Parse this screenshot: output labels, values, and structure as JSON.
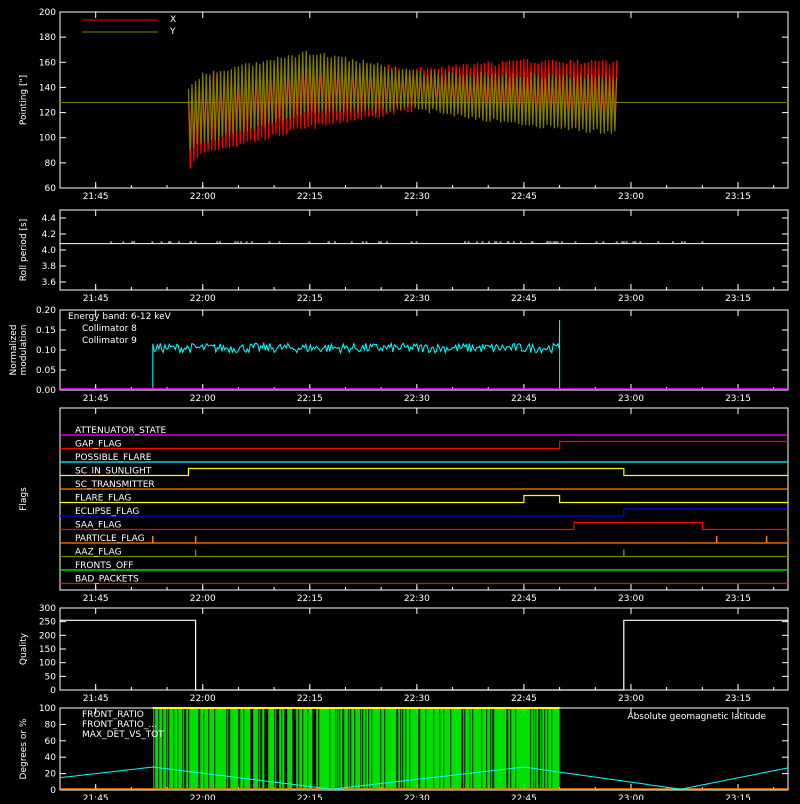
{
  "time_axis": {
    "start": "21:40",
    "end": "23:22",
    "tick_labels": [
      "21:45",
      "22:00",
      "22:15",
      "22:30",
      "22:45",
      "23:00",
      "23:15"
    ]
  },
  "chart_data": [
    {
      "type": "line",
      "name": "pointing",
      "ylabel": "Pointing [\"]",
      "ylim": [
        60,
        200
      ],
      "yticks": [
        "60",
        "80",
        "100",
        "120",
        "140",
        "160",
        "180",
        "200"
      ],
      "legend_placement": "top-left",
      "series": [
        {
          "name": "X",
          "color": "#ff0000",
          "envelope": {
            "time": [
              "21:58",
              "22:00",
              "22:15",
              "22:30",
              "22:45",
              "22:58"
            ],
            "upper": [
              132,
              148,
              162,
              154,
              161,
              160
            ],
            "lower": [
              75,
              88,
              108,
              123,
              114,
              107
            ]
          }
        },
        {
          "name": "Y",
          "color": "#808000",
          "envelope": {
            "time": [
              "21:58",
              "22:00",
              "22:15",
              "22:30",
              "22:45",
              "22:58"
            ],
            "upper": [
              140,
              150,
              168,
              152,
              150,
              148
            ],
            "lower": [
              90,
              96,
              120,
              123,
              110,
              104
            ]
          }
        }
      ],
      "reference_line": {
        "value": 128,
        "color": "#808000"
      }
    },
    {
      "type": "line",
      "name": "roll-period",
      "ylabel": "Roll period [s]",
      "ylim": [
        3.5,
        4.5
      ],
      "yticks": [
        "3.6",
        "3.8",
        "4.0",
        "4.2",
        "4.4"
      ],
      "series": [
        {
          "name": "",
          "color": "#ffffff",
          "value": 4.08
        }
      ]
    },
    {
      "type": "line",
      "name": "modulation",
      "ylabel": "Normalized modulation",
      "ylim": [
        0.0,
        0.2
      ],
      "yticks": [
        "0.00",
        "0.05",
        "0.10",
        "0.15",
        "0.20"
      ],
      "annotation": "Energy band: 6-12 keV",
      "legend_placement": "top-left",
      "series": [
        {
          "name": "Collimator 8",
          "color": "#00ffff",
          "time_range": [
            "21:53",
            "22:50"
          ],
          "mean": 0.105,
          "spread": 0.012,
          "edge_peak": 0.175
        },
        {
          "name": "Collimator 9",
          "color": "#ff00ff",
          "value": 0.0
        }
      ]
    },
    {
      "type": "line",
      "name": "flags",
      "ylabel": "Flags",
      "series": [
        {
          "name": "ATTENUATOR_STATE",
          "color": "#ff00ff",
          "transitions": []
        },
        {
          "name": "SAA_FLAG_",
          "label": "GAP_FLAG",
          "color": "#ff0000",
          "transitions": [
            [
              "22:50",
              "high"
            ]
          ]
        },
        {
          "name": "POSSIBLE_FLARE",
          "color": "#00ffff",
          "transitions": []
        },
        {
          "name": "SC_IN_SUNLIGHT",
          "color": "#ffff00",
          "transitions": [
            [
              "21:58",
              "high"
            ],
            [
              "22:59",
              "low"
            ]
          ]
        },
        {
          "name": "SC_TRANSMITTER",
          "color": "#ff8000",
          "transitions": []
        },
        {
          "name": "FLARE_FLAG",
          "color": "#ffff00",
          "transitions": [
            [
              "22:45",
              "high"
            ],
            [
              "22:50",
              "low"
            ]
          ]
        },
        {
          "name": "ECLIPSE_FLAG",
          "color": "#0000ff",
          "transitions": [
            [
              "21:58",
              "low"
            ],
            [
              "22:59",
              "high"
            ]
          ]
        },
        {
          "name": "SAA_FLAG",
          "color": "#ff0000",
          "transitions": [
            [
              "22:52",
              "high"
            ],
            [
              "23:10",
              "low"
            ]
          ]
        },
        {
          "name": "PARTICLE_FLAG",
          "color": "#ff8000",
          "transitions": []
        },
        {
          "name": "AAZ_FLAG",
          "color": "#808000",
          "transitions": []
        },
        {
          "name": "FRONTS_OFF",
          "color": "#00ff00",
          "transitions": []
        },
        {
          "name": "BAD_PACKETS",
          "color": "#ff0000",
          "transitions": []
        }
      ],
      "spikes": {
        "PARTICLE_FLAG": [
          "21:53",
          "21:59",
          "23:12",
          "23:19",
          "23:22"
        ],
        "AAZ_FLAG": [
          "21:59",
          "22:59"
        ]
      }
    },
    {
      "type": "line",
      "name": "quality",
      "ylabel": "Quality",
      "ylim": [
        0,
        300
      ],
      "yticks": [
        "0",
        "50",
        "100",
        "150",
        "200",
        "250",
        "300"
      ],
      "series": [
        {
          "name": "",
          "color": "#ffffff",
          "points": [
            [
              "21:40",
              255
            ],
            [
              "21:59",
              255
            ],
            [
              "21:59",
              0
            ],
            [
              "22:59",
              0
            ],
            [
              "22:59",
              255
            ],
            [
              "23:22",
              255
            ]
          ]
        }
      ]
    },
    {
      "type": "line",
      "name": "geomagnetic",
      "ylabel": "Degrees or %",
      "ylim": [
        0,
        100
      ],
      "yticks": [
        "0",
        "20",
        "40",
        "60",
        "80",
        "100"
      ],
      "legend_placement": "top-left",
      "series": [
        {
          "name": "FRONT_RATIO",
          "color": "#ffff00",
          "time_range": [
            "21:53",
            "22:50"
          ],
          "value": 100
        },
        {
          "name": "FRONT_RATIO_1",
          "label": "FRONT_RATIO_...",
          "color": "#00ff00",
          "time_range": [
            "21:53",
            "22:50"
          ],
          "value": 100
        },
        {
          "name": "MAX_DET_VS_TOT",
          "color": "#ff8000",
          "value": 0
        },
        {
          "name": "Absolute geomagnetic latitude",
          "color": "#00ffff",
          "points": [
            [
              "21:40",
              15
            ],
            [
              "21:53",
              28
            ],
            [
              "22:18",
              1
            ],
            [
              "22:45",
              28
            ],
            [
              "23:07",
              1
            ],
            [
              "23:22",
              27
            ]
          ]
        }
      ]
    }
  ]
}
